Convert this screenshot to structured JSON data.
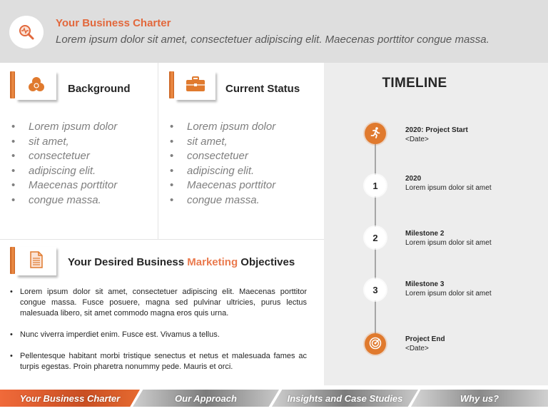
{
  "header": {
    "title": "Your Business Charter",
    "subtitle": "Lorem ipsum dolor sit amet, consectetuer adipiscing elit. Maecenas porttitor congue massa.",
    "icon": "magnifier-chart-icon"
  },
  "background": {
    "heading": "Background",
    "icon": "three-circles-icon",
    "items": [
      "Lorem ipsum dolor",
      "sit amet,",
      "consectetuer",
      "adipiscing elit.",
      "Maecenas porttitor",
      "congue massa."
    ]
  },
  "current_status": {
    "heading": "Current Status",
    "icon": "briefcase-icon",
    "items": [
      "Lorem ipsum dolor",
      "sit amet,",
      "consectetuer",
      "adipiscing elit.",
      "Maecenas porttitor",
      "congue massa."
    ]
  },
  "objectives": {
    "heading_pre": "Your Desired Business ",
    "heading_accent": "Marketing",
    "heading_post": " Objectives",
    "icon": "document-icon",
    "items": [
      "Lorem ipsum dolor sit amet, consectetuer adipiscing elit. Maecenas porttitor congue massa. Fusce posuere, magna sed pulvinar ultricies, purus lectus malesuada libero, sit amet commodo  magna eros quis urna.",
      "Nunc viverra imperdiet enim. Fusce est. Vivamus a tellus.",
      "Pellentesque habitant morbi tristique senectus et netus et malesuada fames ac turpis egestas. Proin pharetra nonummy pede. Mauris et orci."
    ]
  },
  "timeline": {
    "title": "TIMELINE",
    "events": [
      {
        "marker": "runner-icon",
        "title": "2020: Project Start",
        "detail": "<Date>"
      },
      {
        "marker": "1",
        "title": "2020",
        "detail": "Lorem ipsum dolor sit amet"
      },
      {
        "marker": "2",
        "title": "Milestone 2",
        "detail": "Lorem ipsum dolor sit amet"
      },
      {
        "marker": "3",
        "title": "Milestone 3",
        "detail": "Lorem ipsum dolor sit amet"
      },
      {
        "marker": "target-icon",
        "title": "Project End",
        "detail": "<Date>"
      }
    ]
  },
  "footer_nav": {
    "items": [
      "Your Business Charter",
      "Our Approach",
      "Insights and Case Studies",
      "Why us?"
    ],
    "active_index": 0
  },
  "colors": {
    "accent": "#e2683c",
    "icon_orange": "#e07a2e",
    "header_bg": "#dedede",
    "timeline_bg": "#ededed"
  }
}
